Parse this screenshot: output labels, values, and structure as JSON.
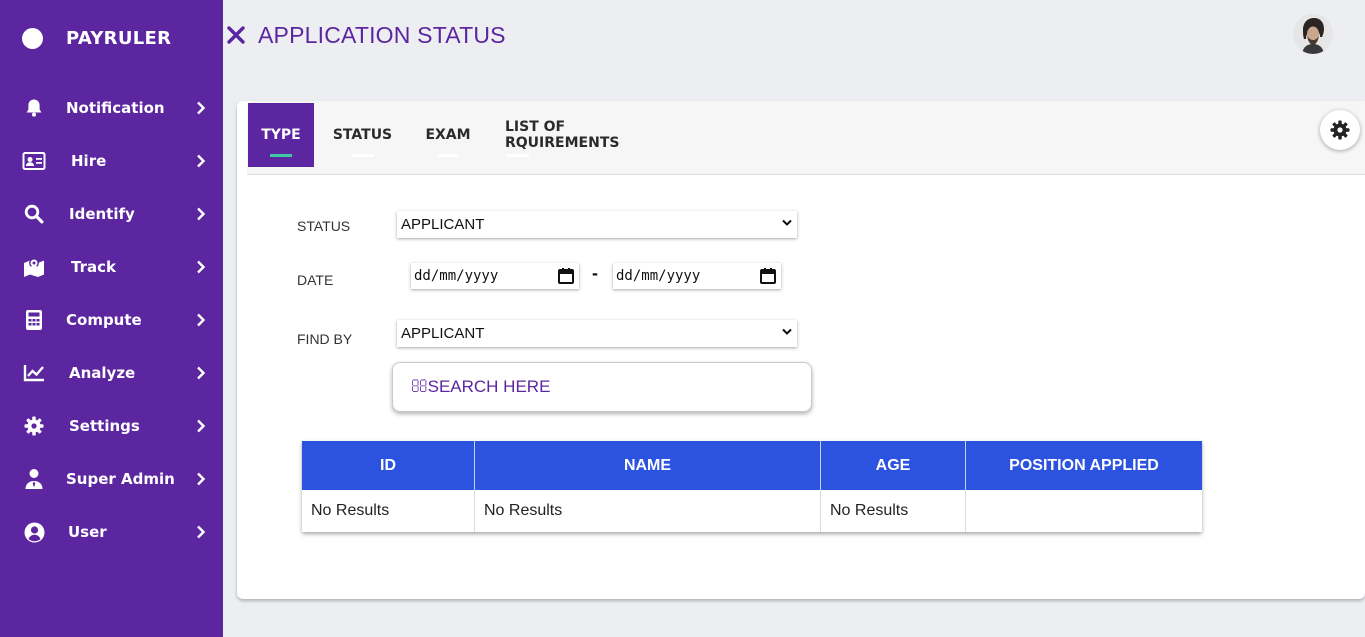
{
  "brand": {
    "name": "PAYRULER"
  },
  "sidebar": {
    "items": [
      {
        "label": "Notification",
        "icon": "bell-icon"
      },
      {
        "label": "Hire",
        "icon": "id-card-icon"
      },
      {
        "label": "Identify",
        "icon": "search-icon"
      },
      {
        "label": "Track",
        "icon": "map-icon"
      },
      {
        "label": "Compute",
        "icon": "calculator-icon"
      },
      {
        "label": "Analyze",
        "icon": "chart-line-icon"
      },
      {
        "label": "Settings",
        "icon": "gear-icon"
      },
      {
        "label": "Super Admin",
        "icon": "user-tie-icon"
      },
      {
        "label": "User",
        "icon": "user-circle-icon"
      }
    ]
  },
  "header": {
    "title": "APPLICATION STATUS"
  },
  "tabs": [
    {
      "label": "TYPE",
      "active": true
    },
    {
      "label": "STATUS",
      "active": false
    },
    {
      "label": "EXAM",
      "active": false
    },
    {
      "label": "LIST OF RQUIREMENTS",
      "active": false
    }
  ],
  "form": {
    "status_label": "STATUS",
    "status_value": "APPLICANT",
    "date_label": "DATE",
    "date_from": "dd/mm/yyyy",
    "date_separator": "-",
    "date_to": "dd/mm/yyyy",
    "findby_label": "FIND BY",
    "findby_value": "APPLICANT",
    "search_placeholder": "SEARCH HERE"
  },
  "table": {
    "headers": [
      "ID",
      "NAME",
      "AGE",
      "POSITION APPLIED"
    ],
    "rows": [
      [
        "No Results",
        "No Results",
        "No Results",
        ""
      ]
    ]
  },
  "colors": {
    "sidebar": "#5b26a0",
    "accent": "#5b26a0",
    "table_header": "#2c52e0",
    "tab_indicator": "#3dc9a3"
  }
}
